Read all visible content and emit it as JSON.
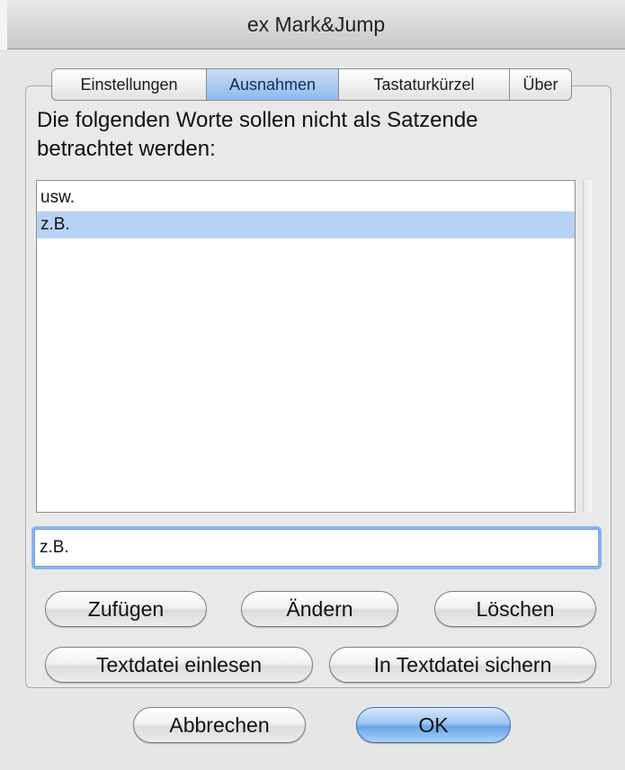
{
  "window": {
    "title": "ex Mark&Jump"
  },
  "tabs": [
    {
      "label": "Einstellungen",
      "selected": false
    },
    {
      "label": "Ausnahmen",
      "selected": true
    },
    {
      "label": "Tastaturkürzel",
      "selected": false
    },
    {
      "label": "Über",
      "selected": false
    }
  ],
  "panel": {
    "description": "Die folgenden Worte sollen nicht als Satzende betrachtet werden:",
    "list": {
      "items": [
        {
          "text": "usw.",
          "selected": false
        },
        {
          "text": "z.B.",
          "selected": true
        }
      ]
    },
    "input": {
      "value": "z.B."
    },
    "buttons": {
      "add": "Zufügen",
      "change": "Ändern",
      "delete": "Löschen",
      "import": "Textdatei einlesen",
      "export": "In Textdatei sichern"
    }
  },
  "footer": {
    "cancel": "Abbrechen",
    "ok": "OK"
  },
  "colors": {
    "selection": "#b7d2f4",
    "tab_selected": "#8fbbea",
    "default_button": "#6aa6ea",
    "focus_ring": "#8ab4ec"
  }
}
